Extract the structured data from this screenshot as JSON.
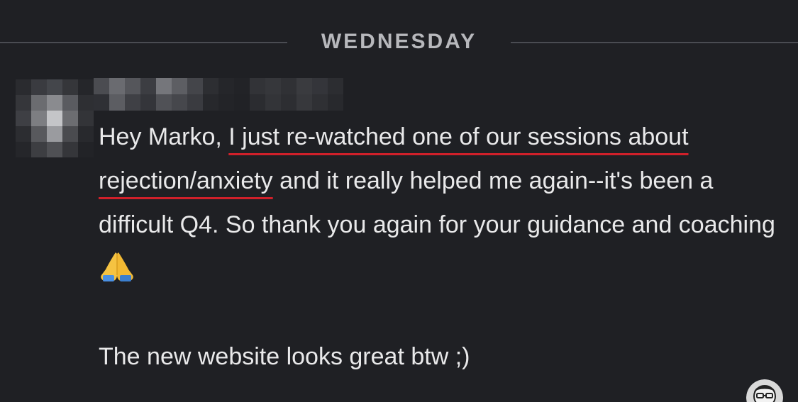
{
  "divider": {
    "day_label": "WEDNESDAY"
  },
  "message": {
    "sender_avatar": "pixelated-avatar",
    "sender_name": "",
    "part_1": "Hey Marko, ",
    "highlight": "I just re-watched one of our sessions about rejection/anxiety",
    "part_2": " and it really helped me again--it's been a difficult Q4. So thank you again for your guidance and coaching ",
    "emoji": "folded-hands-icon",
    "line_2": "The new website looks great btw ;)"
  },
  "colors": {
    "background": "#1f2024",
    "text": "#e9e9ea",
    "divider_text": "#b7b8bc",
    "highlight_underline": "#d0202a"
  },
  "self_avatar": "user-avatar"
}
